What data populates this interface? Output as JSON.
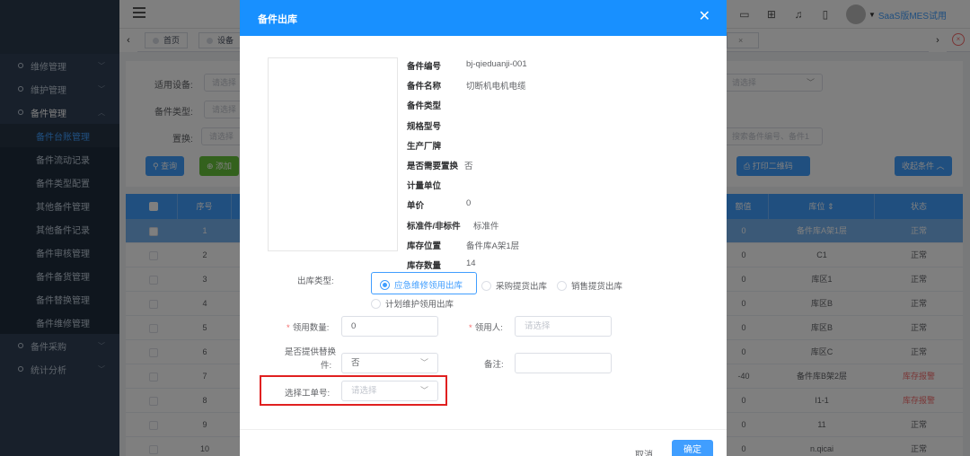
{
  "sidebar": {
    "items": [
      {
        "label": "维修管理",
        "open": false
      },
      {
        "label": "维护管理",
        "open": false
      },
      {
        "label": "备件管理",
        "open": true
      },
      {
        "label": "备件采购",
        "open": false
      },
      {
        "label": "统计分析",
        "open": false
      }
    ],
    "subitems": [
      "备件台账管理",
      "备件流动记录",
      "备件类型配置",
      "其他备件管理",
      "其他备件记录",
      "备件审核管理",
      "备件备货管理",
      "备件替换管理",
      "备件维修管理"
    ],
    "active_sub": "备件台账管理"
  },
  "topbar": {
    "user_name": "SaaS版MES试用"
  },
  "tags": {
    "home": "首页",
    "second": "设备"
  },
  "search": {
    "device_label": "适用设备:",
    "device_placeholder": "请选择",
    "type_label": "备件类型:",
    "type_placeholder": "请选择",
    "replace_label": "置换:",
    "replace_placeholder": "请选择",
    "right_select_placeholder": "请选择",
    "right_search_placeholder": "搜索备件编号、备件1",
    "query_button": "查询",
    "add_button": "添加",
    "print_qr_button": "打印二维码",
    "collapse_button": "收起条件"
  },
  "table": {
    "col_index": "序号",
    "col_value": "额值",
    "col_location": "库位",
    "col_status": "状态",
    "rows": [
      {
        "index": "1",
        "value": "0",
        "location": "备件库A架1层",
        "status": "正常",
        "alert": false
      },
      {
        "index": "2",
        "value": "0",
        "location": "C1",
        "status": "正常",
        "alert": false
      },
      {
        "index": "3",
        "value": "0",
        "location": "库区1",
        "status": "正常",
        "alert": false
      },
      {
        "index": "4",
        "value": "0",
        "location": "库区B",
        "status": "正常",
        "alert": false
      },
      {
        "index": "5",
        "value": "0",
        "location": "库区B",
        "status": "正常",
        "alert": false
      },
      {
        "index": "6",
        "value": "0",
        "location": "库区C",
        "status": "正常",
        "alert": false
      },
      {
        "index": "7",
        "value": "-40",
        "location": "备件库B架2层",
        "status": "库存报警",
        "alert": true
      },
      {
        "index": "8",
        "value": "0",
        "location": "I1-1",
        "status": "库存报警",
        "alert": true
      },
      {
        "index": "9",
        "value": "0",
        "location": "11",
        "status": "正常",
        "alert": false
      },
      {
        "index": "10",
        "value": "0",
        "location": "n.qicai",
        "status": "正常",
        "alert": false
      }
    ]
  },
  "dialog": {
    "title": "备件出库",
    "info": [
      {
        "key": "备件编号",
        "value": "bj-qieduanji-001"
      },
      {
        "key": "备件名称",
        "value": "切断机电机电缆"
      },
      {
        "key": "备件类型",
        "value": ""
      },
      {
        "key": "规格型号",
        "value": ""
      },
      {
        "key": "生产厂牌",
        "value": ""
      },
      {
        "key": "是否需要置换",
        "value": "否"
      },
      {
        "key": "计量单位",
        "value": ""
      },
      {
        "key": "单价",
        "value": "0"
      },
      {
        "key": "标准件/非标件",
        "value": "标准件"
      },
      {
        "key": "库存位置",
        "value": "备件库A架1层"
      },
      {
        "key": "库存数量",
        "value": "14"
      }
    ],
    "outbound_type_label": "出库类型:",
    "outbound_types": [
      "应急维修领用出库",
      "采购提货出库",
      "销售提货出库",
      "计划维护领用出库"
    ],
    "outbound_selected": "应急维修领用出库",
    "qty_label": "领用数量:",
    "qty_value": "0",
    "receiver_label": "领用人:",
    "receiver_placeholder": "请选择",
    "provide_replace_label_1": "是否提供替换",
    "provide_replace_label_2": "件:",
    "provide_replace_value": "否",
    "remark_label": "备注:",
    "remark_value": "",
    "work_order_label": "选择工单号:",
    "work_order_placeholder": "请选择",
    "cancel_button": "取消",
    "ok_button": "确定"
  }
}
